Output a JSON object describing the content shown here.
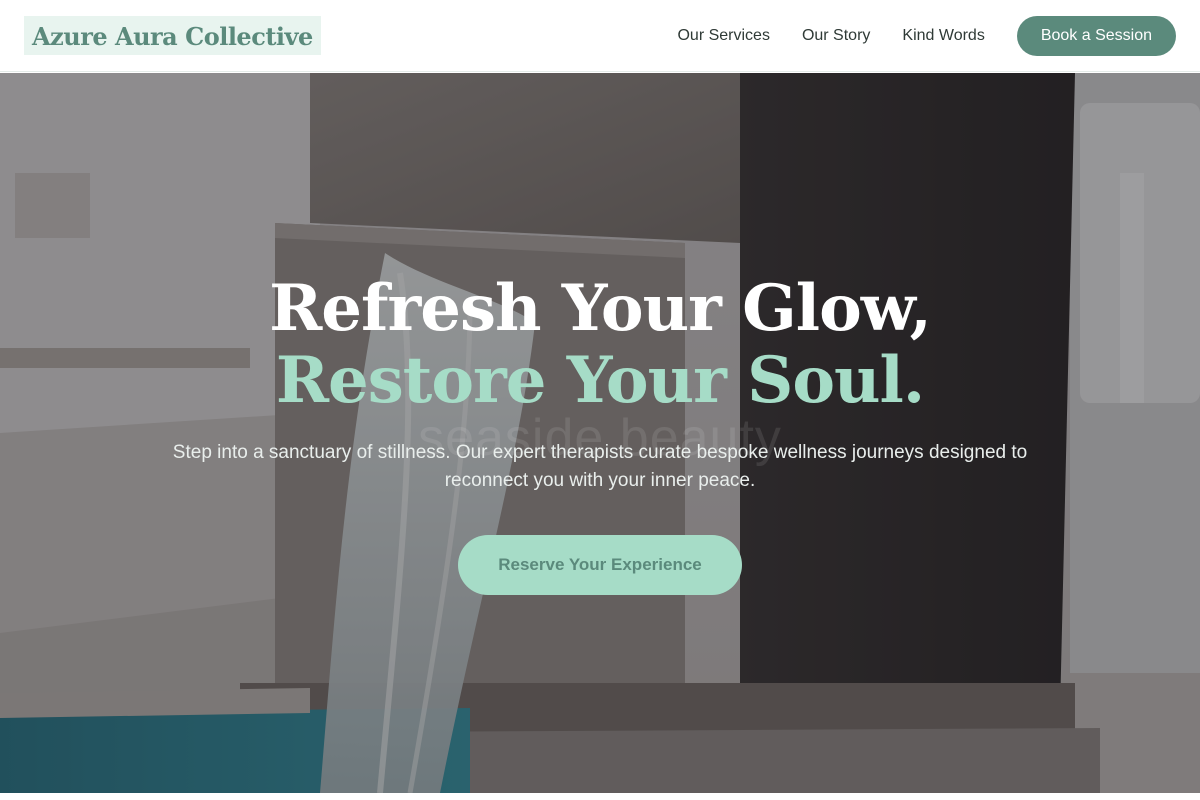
{
  "header": {
    "logo": "Azure Aura Collective",
    "nav": [
      {
        "label": "Our Services"
      },
      {
        "label": "Our Story"
      },
      {
        "label": "Kind Words"
      }
    ],
    "cta_label": "Book a Session"
  },
  "hero": {
    "headline_line1": "Refresh Your Glow,",
    "headline_line2": "Restore Your Soul.",
    "ghost_text": "seaside beauty",
    "subtitle": "Step into a sanctuary of stillness. Our expert therapists curate bespoke wellness journeys designed to reconnect you with your inner peace.",
    "cta_label": "Reserve Your Experience"
  },
  "colors": {
    "brand": "#5b8a7c",
    "accent_mint": "#a6dcc7",
    "logo_bg": "#e8f4ef",
    "nav_text": "#2f3a36"
  }
}
